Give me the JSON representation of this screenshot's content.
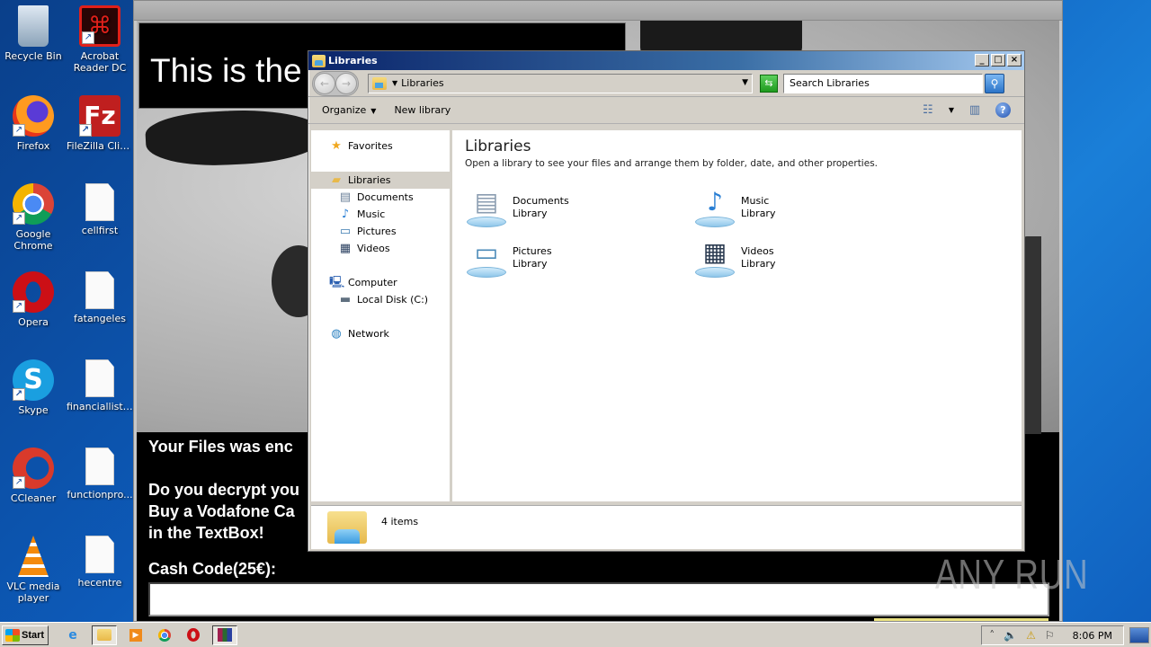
{
  "desktop": {
    "icons": [
      {
        "label": "Recycle Bin",
        "icon": "recycle-bin-icon",
        "shortcut": false
      },
      {
        "label": "Acrobat Reader DC",
        "icon": "acrobat-icon",
        "shortcut": true
      },
      {
        "label": "Firefox",
        "icon": "firefox-icon",
        "shortcut": true
      },
      {
        "label": "FileZilla Client",
        "icon": "filezilla-icon",
        "shortcut": true
      },
      {
        "label": "Google Chrome",
        "icon": "chrome-icon",
        "shortcut": true
      },
      {
        "label": "cellfirst",
        "icon": "file-icon",
        "shortcut": false
      },
      {
        "label": "Opera",
        "icon": "opera-icon",
        "shortcut": true
      },
      {
        "label": "fatangeles",
        "icon": "file-icon",
        "shortcut": false
      },
      {
        "label": "Skype",
        "icon": "skype-icon",
        "shortcut": true
      },
      {
        "label": "financiallistings",
        "icon": "file-icon",
        "shortcut": false
      },
      {
        "label": "CCleaner",
        "icon": "ccleaner-icon",
        "shortcut": true
      },
      {
        "label": "functionpro...",
        "icon": "file-icon",
        "shortcut": false
      },
      {
        "label": "VLC media player",
        "icon": "vlc-icon",
        "shortcut": true
      },
      {
        "label": "hecentre",
        "icon": "file-icon",
        "shortcut": false
      }
    ]
  },
  "ransom_window": {
    "headline": "This is the",
    "message_lines": [
      "Your Files was enc",
      "",
      "Do you decrypt you",
      "Buy a Vodafone Ca",
      "in the TextBox!"
    ],
    "cash_label": "Cash Code(25€):",
    "cash_input_value": ""
  },
  "explorer": {
    "title": "Libraries",
    "window_buttons": {
      "minimize": "_",
      "maximize": "□",
      "close": "×"
    },
    "address": {
      "crumb": "Libraries"
    },
    "search": {
      "placeholder": "Search Libraries"
    },
    "toolbar": {
      "organize": "Organize",
      "new_library": "New library"
    },
    "nav": {
      "favorites": "Favorites",
      "libraries": "Libraries",
      "library_items": [
        "Documents",
        "Music",
        "Pictures",
        "Videos"
      ],
      "computer": "Computer",
      "computer_items": [
        "Local Disk (C:)"
      ],
      "network": "Network"
    },
    "main": {
      "heading": "Libraries",
      "description": "Open a library to see your files and arrange them by folder, date, and other properties.",
      "libraries": [
        {
          "name": "Documents",
          "type": "Library",
          "icon": "documents-library-icon"
        },
        {
          "name": "Music",
          "type": "Library",
          "icon": "music-library-icon"
        },
        {
          "name": "Pictures",
          "type": "Library",
          "icon": "pictures-library-icon"
        },
        {
          "name": "Videos",
          "type": "Library",
          "icon": "videos-library-icon"
        }
      ]
    },
    "status": {
      "items_count": "4 items"
    }
  },
  "taskbar": {
    "start_label": "Start",
    "quick_launch": [
      "internet-explorer-icon",
      "explorer-icon",
      "media-player-icon",
      "chrome-icon",
      "opera-icon",
      "winrar-icon"
    ],
    "clock": "8:06 PM"
  },
  "watermark": "ANY RUN",
  "colors": {
    "titlebar_start": "#0a246a",
    "titlebar_end": "#a6caf0",
    "desktop_blue": "#0d5ab8"
  }
}
